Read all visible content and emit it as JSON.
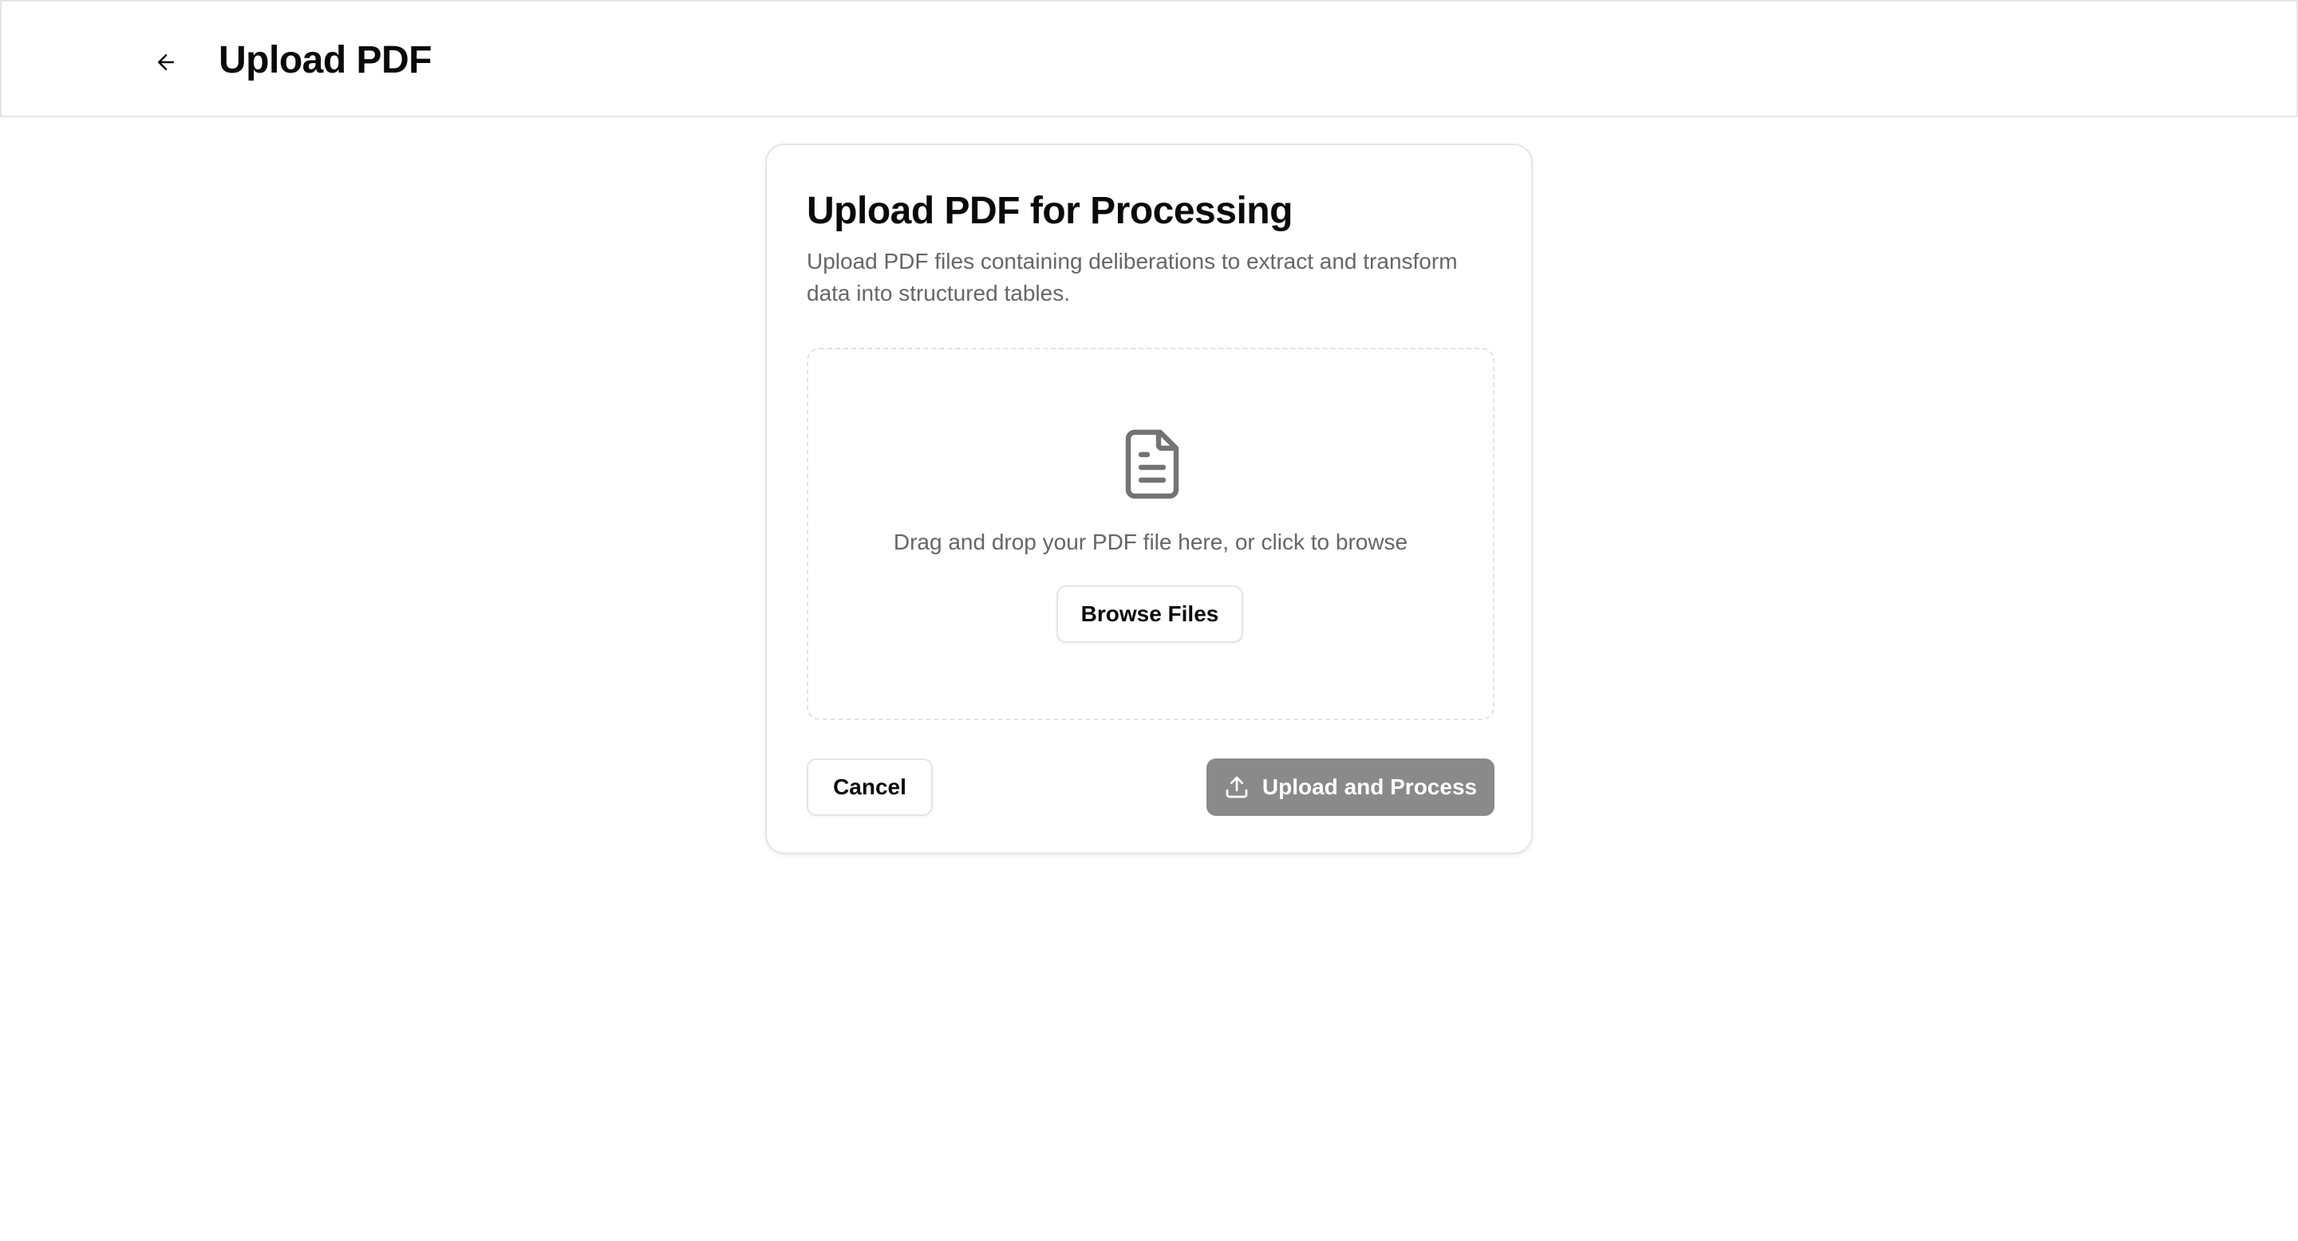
{
  "header": {
    "title": "Upload PDF",
    "back_icon": "arrow-left-icon"
  },
  "card": {
    "title": "Upload PDF for Processing",
    "description": "Upload PDF files containing deliberations to extract and transform data into structured tables."
  },
  "dropzone": {
    "icon": "file-text-icon",
    "instruction": "Drag and drop your PDF file here, or click to browse",
    "browse_label": "Browse Files"
  },
  "actions": {
    "cancel_label": "Cancel",
    "upload_label": "Upload and Process",
    "upload_icon": "upload-icon",
    "upload_disabled": true
  },
  "colors": {
    "primary_disabled": "#8a8a8a",
    "border": "#e5e5e5",
    "muted_text": "#666666",
    "text": "#0a0a0a"
  }
}
